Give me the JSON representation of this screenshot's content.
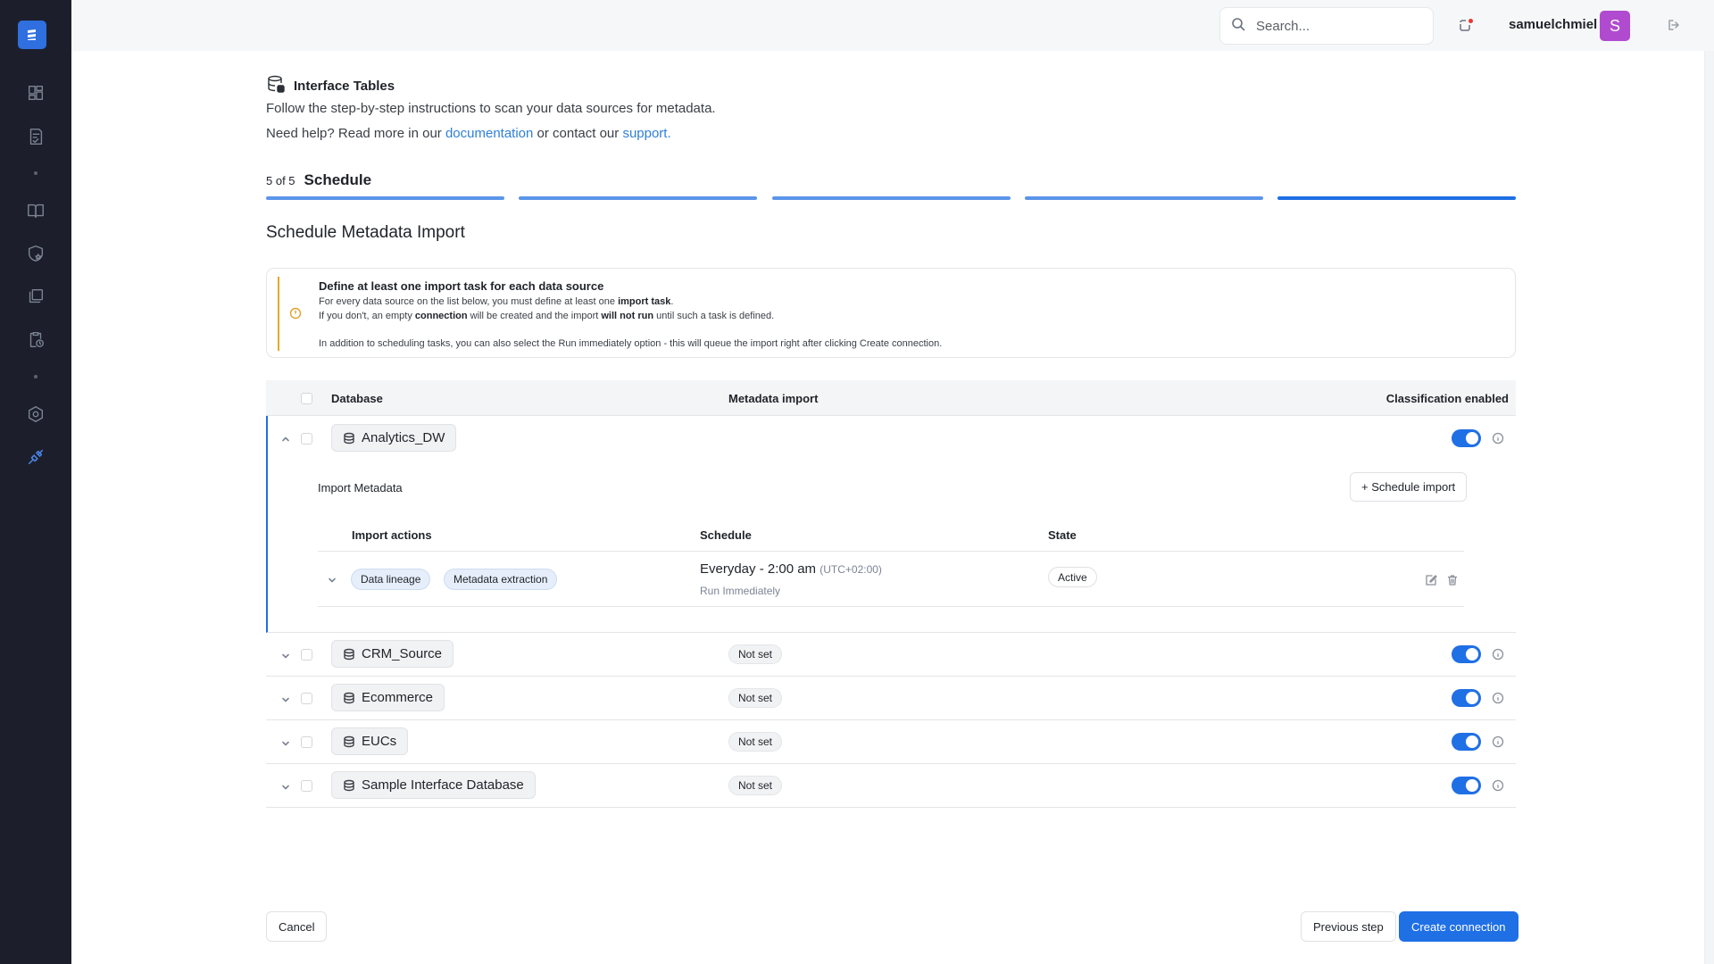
{
  "sidebar": {
    "logo_icon": "stack-logo-icon",
    "items": [
      {
        "icon": "dashboard-icon"
      },
      {
        "icon": "checklist-icon"
      },
      {
        "icon": "book-icon"
      },
      {
        "icon": "shield-star-icon"
      },
      {
        "icon": "layers-icon"
      },
      {
        "icon": "clipboard-clock-icon"
      },
      {
        "icon": "settings-hexagon-icon"
      },
      {
        "icon": "connection-plug-icon",
        "active": true
      }
    ]
  },
  "topbar": {
    "search_placeholder": "Search...",
    "username": "samuelchmiel",
    "avatar_initial": "S",
    "avatar_color": "#b04bcf"
  },
  "page": {
    "title": "Interface Tables",
    "intro": "Follow the step-by-step instructions to scan your data sources for metadata.",
    "help_prefix": "Need help? Read more in our ",
    "help_link_doc": "documentation",
    "help_mid": " or contact our ",
    "help_link_support": "support."
  },
  "stepper": {
    "count": "5 of 5",
    "name": "Schedule",
    "total_steps": 5,
    "current_step": 5
  },
  "section_title": "Schedule Metadata Import",
  "notice": {
    "heading": "Define at least one import task for each data source",
    "line1_a": "For every data source on the list below, you must define at least one ",
    "line1_b": "import task",
    "line1_c": ".",
    "line2_a": "If you don't, an empty ",
    "line2_b": "connection",
    "line2_c": " will be created and the import ",
    "line2_d": "will not run",
    "line2_e": " until such a task is defined.",
    "line3": "In addition to scheduling tasks, you can also select the Run immediately option - this will queue the import right after clicking Create connection."
  },
  "table": {
    "columns": {
      "database": "Database",
      "metadata_import": "Metadata import",
      "classification": "Classification enabled"
    },
    "expanded_row": {
      "database": "Analytics_DW",
      "classification_enabled": true,
      "import_label": "Import Metadata",
      "schedule_button": "+ Schedule import",
      "inner_columns": {
        "actions": "Import actions",
        "schedule": "Schedule",
        "state": "State"
      },
      "task": {
        "actions": [
          "Data lineage",
          "Metadata extraction"
        ],
        "schedule": "Everyday - 2:00 am",
        "timezone": "(UTC+02:00)",
        "run_note": "Run Immediately",
        "state": "Active"
      }
    },
    "rows": [
      {
        "database": "CRM_Source",
        "metadata_import": "Not set",
        "classification_enabled": true
      },
      {
        "database": "Ecommerce",
        "metadata_import": "Not set",
        "classification_enabled": true
      },
      {
        "database": "EUCs",
        "metadata_import": "Not set",
        "classification_enabled": true
      },
      {
        "database": "Sample Interface Database",
        "metadata_import": "Not set",
        "classification_enabled": true
      }
    ]
  },
  "footer": {
    "cancel": "Cancel",
    "previous": "Previous step",
    "create": "Create connection"
  },
  "colors": {
    "accent": "#1f6fe5",
    "sidebar_bg": "#1c1f2b",
    "warning": "#e7a72a",
    "link": "#2f7fd8"
  }
}
